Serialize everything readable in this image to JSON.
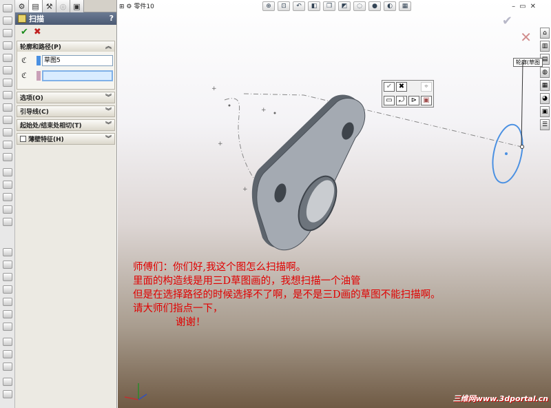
{
  "app": {
    "doc_title": "零件10"
  },
  "panel": {
    "feature_title": "扫描",
    "help_icon": "?",
    "ok_icon": "✔",
    "cancel_icon": "✖",
    "groups": {
      "profile_path": {
        "label": "轮廓和路径(P)",
        "profile_value": "草图5",
        "path_value": ""
      },
      "options": {
        "label": "选项(O)"
      },
      "guide": {
        "label": "引导线(C)"
      },
      "start_end": {
        "label": "起始处/结束处相切(T)"
      },
      "thin": {
        "label": "薄壁特征(H)"
      }
    }
  },
  "viewport": {
    "sketch_tag": "轮廓(草图"
  },
  "question": {
    "line1": "师傅们：你们好,我这个图怎么扫描啊。",
    "line2": "里面的构造线是用三D草图画的，我想扫描一个油管",
    "line3": "但是在选择路径的时候选择不了啊，是不是三D画的草图不能扫描啊。",
    "line4": "请大师们指点一下，",
    "line5": "谢谢！"
  },
  "watermark": "三维网www.3dportal.cn",
  "colors": {
    "question_text": "#e00000",
    "path_highlight": "#4a90e2",
    "part_gray": "#808890"
  }
}
